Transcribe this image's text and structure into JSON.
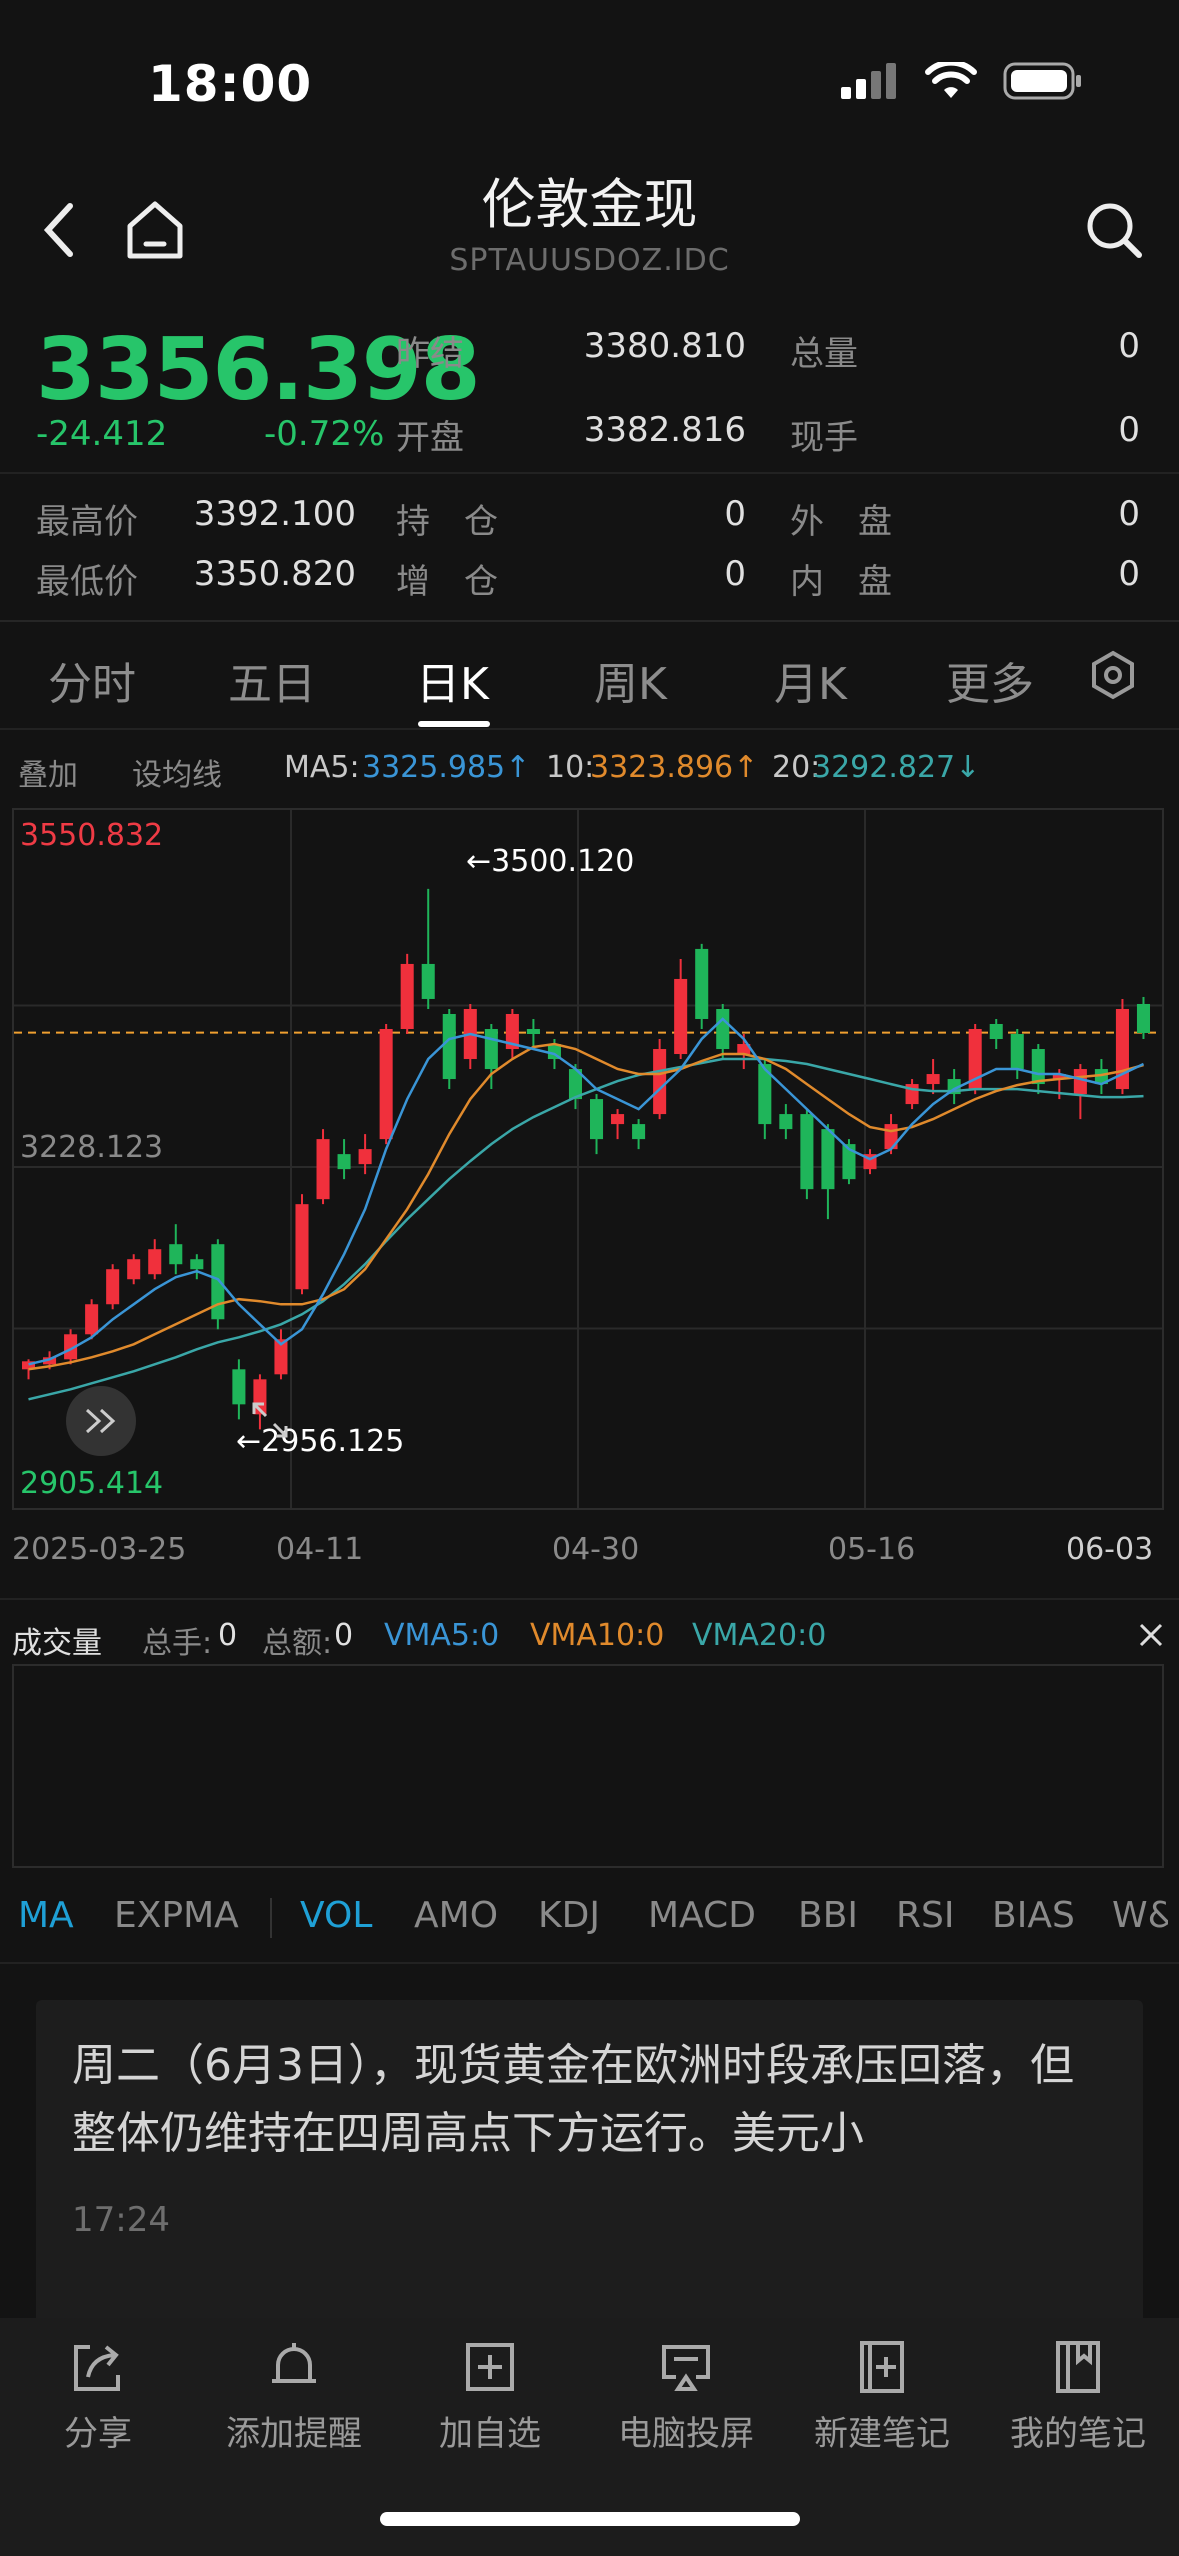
{
  "status": {
    "time": "18:00"
  },
  "header": {
    "title": "伦敦金现",
    "subtitle": "SPTAUUSDOZ.IDC"
  },
  "quote": {
    "price": "3356.398",
    "change": "-24.412",
    "change_pct": "-0.72%",
    "rows": [
      {
        "label": "昨结",
        "value": "3380.810",
        "label2": "总量",
        "value2": "0"
      },
      {
        "label": "开盘",
        "value": "3382.816",
        "label2": "现手",
        "value2": "0"
      }
    ],
    "stats": [
      {
        "label": "最高价",
        "value": "3392.100",
        "label2": "持　仓",
        "value2": "0",
        "label3": "外　盘",
        "value3": "0"
      },
      {
        "label": "最低价",
        "value": "3350.820",
        "label2": "增　仓",
        "value2": "0",
        "label3": "内　盘",
        "value3": "0"
      }
    ]
  },
  "tabs": [
    "分时",
    "五日",
    "日K",
    "周K",
    "月K",
    "更多"
  ],
  "ma": {
    "overlay_label": "叠加",
    "set_ma_label": "设均线",
    "ma5_label": "MA5:",
    "ma5_value": "3325.985↑",
    "ma10_label": "10:",
    "ma10_value": "3323.896↑",
    "ma20_label": "20:",
    "ma20_value": "3292.827↓"
  },
  "chart_labels": {
    "y_top": "3550.832",
    "y_mid": "3228.123",
    "y_bottom": "2905.414",
    "high_label": "3500.120",
    "low_label": "2956.125",
    "x_ticks": [
      "2025-03-25",
      "04-11",
      "04-30",
      "05-16",
      "06-03"
    ]
  },
  "colors": {
    "up": "#f0303c",
    "down": "#1fb55a",
    "ma5": "#3a95d6",
    "ma10": "#e08a2c",
    "ma20": "#3aa7a8",
    "current_line": "#f0a030"
  },
  "chart_data": {
    "type": "candlestick",
    "ylim": [
      2905.414,
      3550.832
    ],
    "current_price": 3356.398,
    "x_labels": [
      "2025-03-25",
      "04-11",
      "04-30",
      "05-16",
      "06-03"
    ],
    "candles": [
      [
        3020,
        3028,
        3010,
        3030
      ],
      [
        3025,
        3032,
        3020,
        3038
      ],
      [
        3030,
        3055,
        3025,
        3060
      ],
      [
        3055,
        3085,
        3050,
        3090
      ],
      [
        3085,
        3120,
        3080,
        3125
      ],
      [
        3110,
        3130,
        3105,
        3135
      ],
      [
        3115,
        3140,
        3110,
        3150
      ],
      [
        3145,
        3125,
        3115,
        3165
      ],
      [
        3130,
        3120,
        3110,
        3135
      ],
      [
        3145,
        3070,
        3060,
        3150
      ],
      [
        3020,
        2985,
        2970,
        3030
      ],
      [
        2975,
        3010,
        2960,
        3015
      ],
      [
        3015,
        3050,
        3010,
        3060
      ],
      [
        3100,
        3185,
        3095,
        3195
      ],
      [
        3190,
        3250,
        3185,
        3260
      ],
      [
        3235,
        3220,
        3210,
        3250
      ],
      [
        3225,
        3240,
        3215,
        3255
      ],
      [
        3250,
        3360,
        3245,
        3365
      ],
      [
        3360,
        3425,
        3355,
        3435
      ],
      [
        3425,
        3390,
        3380,
        3500
      ],
      [
        3375,
        3310,
        3300,
        3380
      ],
      [
        3330,
        3380,
        3320,
        3385
      ],
      [
        3360,
        3320,
        3300,
        3365
      ],
      [
        3340,
        3375,
        3330,
        3380
      ],
      [
        3360,
        3355,
        3340,
        3370
      ],
      [
        3345,
        3330,
        3320,
        3350
      ],
      [
        3320,
        3290,
        3280,
        3325
      ],
      [
        3290,
        3250,
        3235,
        3295
      ],
      [
        3265,
        3275,
        3250,
        3280
      ],
      [
        3265,
        3250,
        3240,
        3270
      ],
      [
        3275,
        3340,
        3270,
        3350
      ],
      [
        3335,
        3410,
        3330,
        3430
      ],
      [
        3440,
        3370,
        3360,
        3445
      ],
      [
        3380,
        3340,
        3330,
        3385
      ],
      [
        3335,
        3345,
        3320,
        3355
      ],
      [
        3325,
        3265,
        3250,
        3330
      ],
      [
        3275,
        3260,
        3250,
        3285
      ],
      [
        3275,
        3200,
        3190,
        3280
      ],
      [
        3260,
        3200,
        3170,
        3265
      ],
      [
        3245,
        3210,
        3205,
        3250
      ],
      [
        3220,
        3235,
        3215,
        3240
      ],
      [
        3240,
        3265,
        3235,
        3275
      ],
      [
        3285,
        3305,
        3280,
        3310
      ],
      [
        3305,
        3315,
        3295,
        3330
      ],
      [
        3310,
        3295,
        3285,
        3320
      ],
      [
        3300,
        3360,
        3295,
        3365
      ],
      [
        3365,
        3350,
        3340,
        3370
      ],
      [
        3355,
        3320,
        3310,
        3360
      ],
      [
        3340,
        3305,
        3295,
        3345
      ],
      [
        3310,
        3315,
        3290,
        3320
      ],
      [
        3295,
        3320,
        3270,
        3325
      ],
      [
        3320,
        3305,
        3295,
        3330
      ],
      [
        3300,
        3380,
        3295,
        3390
      ],
      [
        3385,
        3356,
        3350,
        3392
      ]
    ],
    "ma5": [
      3025,
      3030,
      3040,
      3052,
      3070,
      3085,
      3100,
      3112,
      3118,
      3110,
      3085,
      3065,
      3045,
      3060,
      3095,
      3135,
      3180,
      3240,
      3290,
      3330,
      3350,
      3355,
      3350,
      3345,
      3340,
      3335,
      3320,
      3300,
      3290,
      3280,
      3300,
      3320,
      3350,
      3370,
      3350,
      3320,
      3300,
      3280,
      3260,
      3240,
      3230,
      3240,
      3265,
      3285,
      3300,
      3310,
      3320,
      3320,
      3315,
      3315,
      3310,
      3305,
      3315,
      3325
    ],
    "ma10": [
      3020,
      3023,
      3027,
      3032,
      3038,
      3045,
      3055,
      3065,
      3075,
      3085,
      3090,
      3088,
      3085,
      3085,
      3090,
      3100,
      3120,
      3150,
      3180,
      3215,
      3255,
      3290,
      3315,
      3330,
      3342,
      3345,
      3340,
      3330,
      3320,
      3315,
      3315,
      3320,
      3328,
      3335,
      3335,
      3330,
      3320,
      3305,
      3290,
      3275,
      3262,
      3258,
      3262,
      3270,
      3280,
      3290,
      3298,
      3304,
      3308,
      3310,
      3312,
      3314,
      3318,
      3324
    ],
    "ma20": [
      2990,
      2995,
      3000,
      3006,
      3012,
      3018,
      3025,
      3032,
      3040,
      3047,
      3052,
      3058,
      3065,
      3075,
      3088,
      3105,
      3125,
      3148,
      3170,
      3190,
      3210,
      3228,
      3245,
      3260,
      3272,
      3282,
      3292,
      3300,
      3308,
      3314,
      3318,
      3322,
      3326,
      3330,
      3330,
      3330,
      3328,
      3325,
      3320,
      3315,
      3310,
      3305,
      3300,
      3298,
      3298,
      3300,
      3300,
      3300,
      3298,
      3296,
      3294,
      3292,
      3292,
      3293
    ]
  },
  "volume": {
    "title": "成交量",
    "total_hands_label": "总手:",
    "total_hands": "0",
    "total_amount_label": "总额:",
    "total_amount": "0",
    "vma5": "VMA5:0",
    "vma10": "VMA10:0",
    "vma20": "VMA20:0"
  },
  "indicators": [
    "MA",
    "EXPMA",
    "VOL",
    "AMO",
    "KDJ",
    "MACD",
    "BBI",
    "RSI",
    "BIAS",
    "W&"
  ],
  "news": {
    "text": "周二（6月3日），现货黄金在欧洲时段承压回落，但整体仍维持在四周高点下方运行。美元小",
    "time": "17:24"
  },
  "bottom_bar": [
    {
      "label": "分享",
      "icon": "share-icon"
    },
    {
      "label": "添加提醒",
      "icon": "bell-icon"
    },
    {
      "label": "加自选",
      "icon": "add-box-icon"
    },
    {
      "label": "电脑投屏",
      "icon": "cast-icon"
    },
    {
      "label": "新建笔记",
      "icon": "new-note-icon"
    },
    {
      "label": "我的笔记",
      "icon": "notebook-icon"
    }
  ]
}
